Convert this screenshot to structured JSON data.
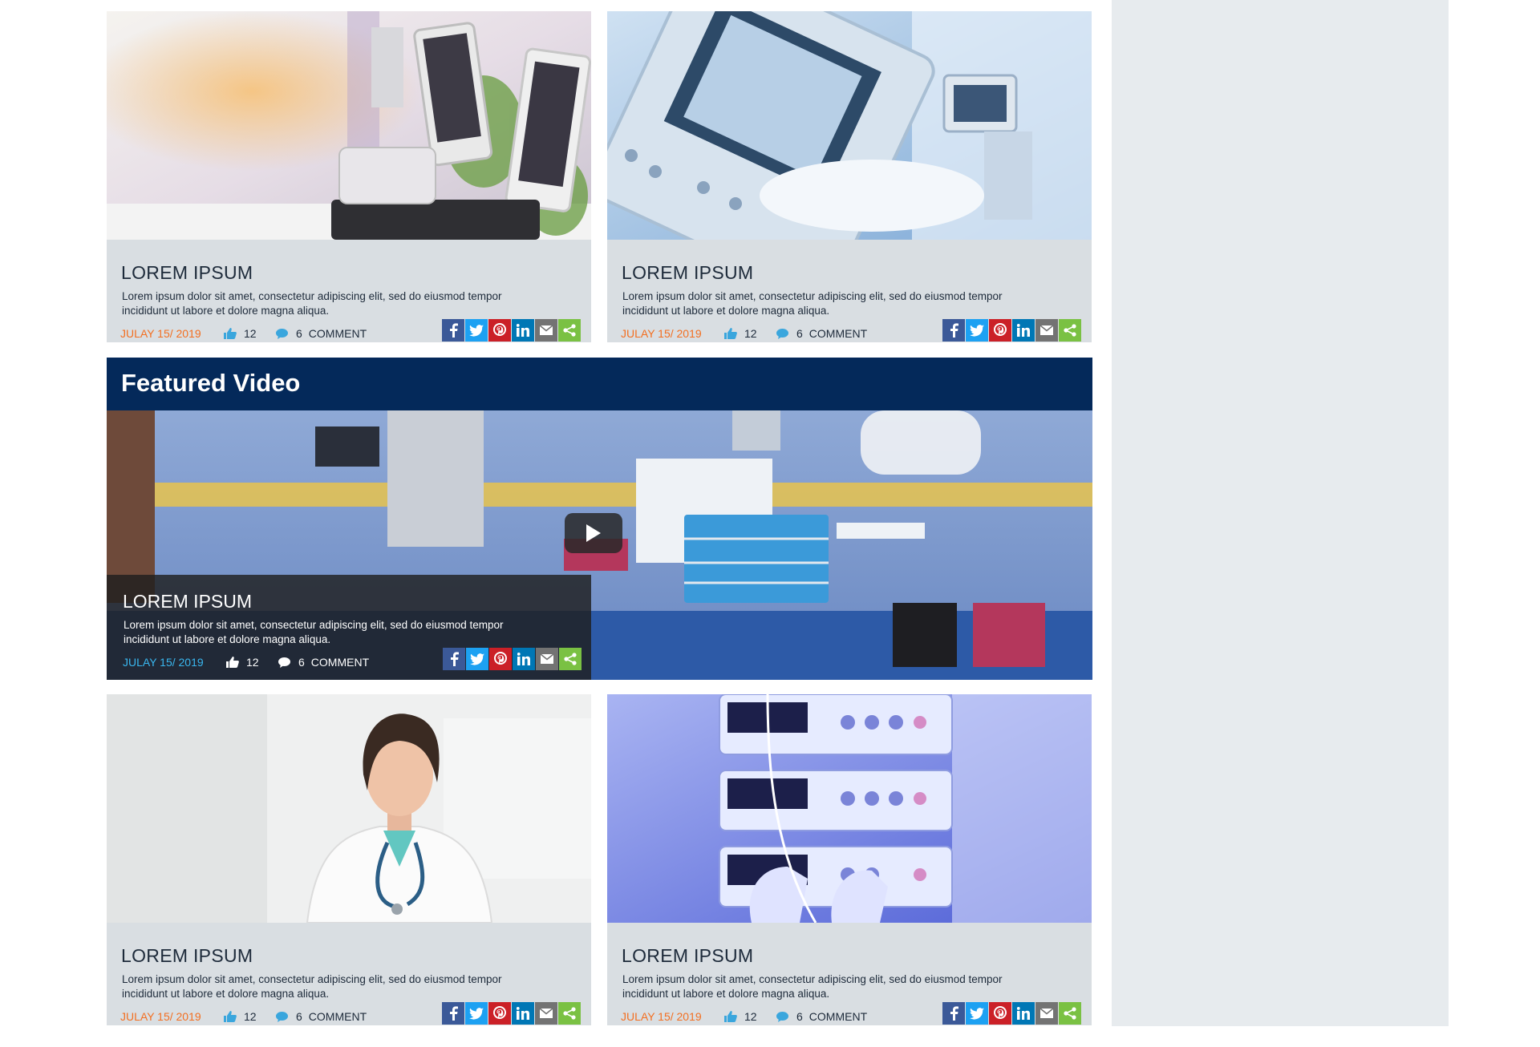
{
  "posts": [
    {
      "title": "LOREM IPSUM",
      "desc": "Lorem ipsum dolor sit amet, consectetur adipiscing elit, sed do eiusmod tempor incididunt ut labore et dolore magna aliqua.",
      "date": "JULAY 15/ 2019",
      "likes": "12",
      "comments": "6",
      "comment_label": "COMMENT"
    },
    {
      "title": "LOREM IPSUM",
      "desc": "Lorem ipsum dolor sit amet, consectetur adipiscing elit, sed do eiusmod tempor incididunt ut labore et dolore magna aliqua.",
      "date": "JULAY 15/ 2019",
      "likes": "12",
      "comments": "6",
      "comment_label": "COMMENT"
    },
    {
      "title": "LOREM IPSUM",
      "desc": "Lorem ipsum dolor sit amet, consectetur adipiscing elit, sed do eiusmod tempor incididunt ut labore et dolore magna aliqua.",
      "date": "JULAY 15/ 2019",
      "likes": "12",
      "comments": "6",
      "comment_label": "COMMENT"
    },
    {
      "title": "LOREM IPSUM",
      "desc": "Lorem ipsum dolor sit amet, consectetur adipiscing elit, sed do eiusmod tempor incididunt ut labore et dolore magna aliqua.",
      "date": "JULAY 15/ 2019",
      "likes": "12",
      "comments": "6",
      "comment_label": "COMMENT"
    }
  ],
  "featured": {
    "heading": "Featured Video",
    "title": "LOREM IPSUM",
    "desc": "Lorem ipsum dolor sit amet, consectetur adipiscing elit, sed do eiusmod tempor incididunt ut labore et dolore magna aliqua.",
    "date": "JULAY 15/ 2019",
    "likes": "12",
    "comments": "6",
    "comment_label": "COMMENT"
  },
  "share_icons": [
    "facebook-icon",
    "twitter-icon",
    "pinterest-icon",
    "linkedin-icon",
    "email-icon",
    "share-icon"
  ],
  "colors": {
    "date": "#f36f21",
    "featured_date": "#39b7ef",
    "header": "#04295a",
    "card_bg": "#d9dee2",
    "sidebar_bg": "#e7ebee"
  }
}
